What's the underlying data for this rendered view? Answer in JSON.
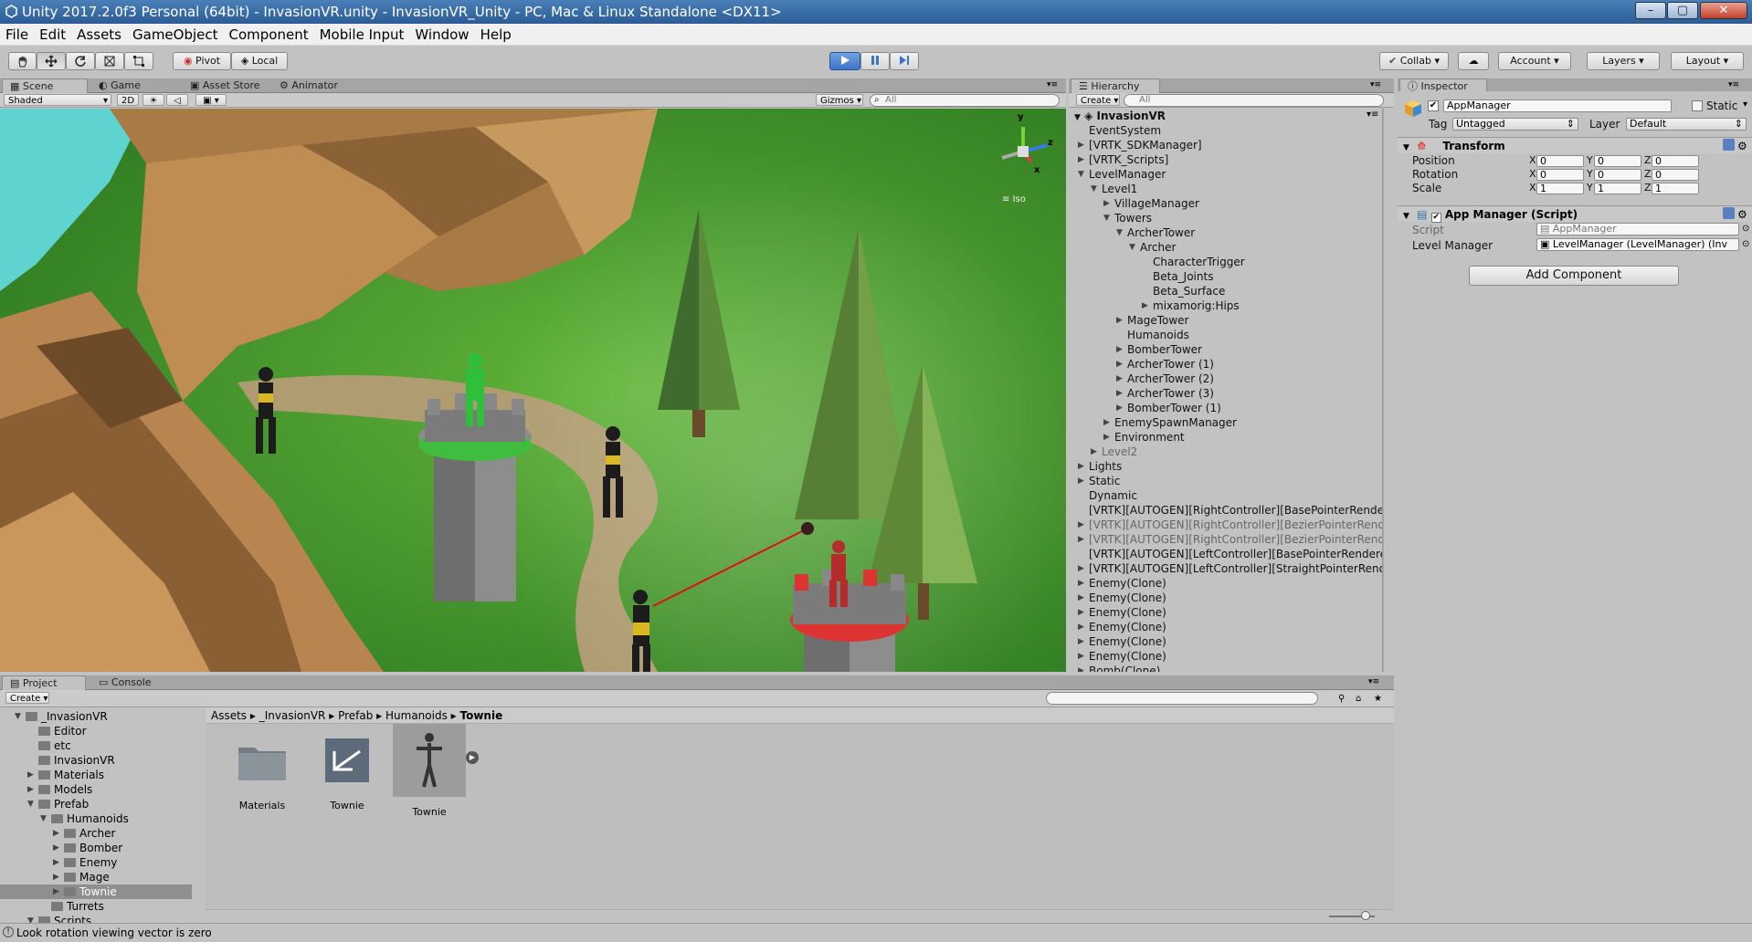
{
  "window": {
    "title": "Unity 2017.2.0f3 Personal (64bit) - InvasionVR.unity - InvasionVR_Unity - PC, Mac & Linux Standalone <DX11>"
  },
  "menu": [
    "File",
    "Edit",
    "Assets",
    "GameObject",
    "Component",
    "Mobile Input",
    "Window",
    "Help"
  ],
  "toolbar": {
    "pivot": "Pivot",
    "local": "Local",
    "collab": "Collab",
    "account": "Account",
    "layers": "Layers",
    "layout": "Layout"
  },
  "scene_tabs": {
    "scene": "Scene",
    "game": "Game",
    "asset_store": "Asset Store",
    "animator": "Animator"
  },
  "scene_bar": {
    "shading": "Shaded",
    "mode2d": "2D",
    "gizmos": "Gizmos",
    "search": "All",
    "iso": "Iso",
    "axis_y": "y",
    "axis_z": "z",
    "axis_x": "x"
  },
  "hierarchy": {
    "tab": "Hierarchy",
    "create": "Create",
    "search": "All",
    "scene_name": "InvasionVR",
    "items": [
      {
        "label": "EventSystem",
        "depth": 0,
        "arrow": "",
        "style": ""
      },
      {
        "label": "[VRTK_SDKManager]",
        "depth": 0,
        "arrow": "right",
        "style": ""
      },
      {
        "label": "[VRTK_Scripts]",
        "depth": 0,
        "arrow": "right",
        "style": ""
      },
      {
        "label": "LevelManager",
        "depth": 0,
        "arrow": "down",
        "style": ""
      },
      {
        "label": "Level1",
        "depth": 1,
        "arrow": "down",
        "style": ""
      },
      {
        "label": "VillageManager",
        "depth": 2,
        "arrow": "right",
        "style": ""
      },
      {
        "label": "Towers",
        "depth": 2,
        "arrow": "down",
        "style": ""
      },
      {
        "label": "ArcherTower",
        "depth": 3,
        "arrow": "down",
        "style": ""
      },
      {
        "label": "Archer",
        "depth": 4,
        "arrow": "down",
        "style": ""
      },
      {
        "label": "CharacterTrigger",
        "depth": 5,
        "arrow": "",
        "style": ""
      },
      {
        "label": "Beta_Joints",
        "depth": 5,
        "arrow": "",
        "style": ""
      },
      {
        "label": "Beta_Surface",
        "depth": 5,
        "arrow": "",
        "style": ""
      },
      {
        "label": "mixamorig:Hips",
        "depth": 5,
        "arrow": "right",
        "style": ""
      },
      {
        "label": "MageTower",
        "depth": 3,
        "arrow": "right",
        "style": ""
      },
      {
        "label": "Humanoids",
        "depth": 3,
        "arrow": "",
        "style": ""
      },
      {
        "label": "BomberTower",
        "depth": 3,
        "arrow": "right",
        "style": ""
      },
      {
        "label": "ArcherTower (1)",
        "depth": 3,
        "arrow": "right",
        "style": ""
      },
      {
        "label": "ArcherTower (2)",
        "depth": 3,
        "arrow": "right",
        "style": ""
      },
      {
        "label": "ArcherTower (3)",
        "depth": 3,
        "arrow": "right",
        "style": ""
      },
      {
        "label": "BomberTower (1)",
        "depth": 3,
        "arrow": "right",
        "style": ""
      },
      {
        "label": "EnemySpawnManager",
        "depth": 2,
        "arrow": "right",
        "style": ""
      },
      {
        "label": "Environment",
        "depth": 2,
        "arrow": "right",
        "style": ""
      },
      {
        "label": "Level2",
        "depth": 1,
        "arrow": "right",
        "style": "dim"
      },
      {
        "label": "Lights",
        "depth": 0,
        "arrow": "right",
        "style": ""
      },
      {
        "label": "Static",
        "depth": 0,
        "arrow": "right",
        "style": ""
      },
      {
        "label": "Dynamic",
        "depth": 0,
        "arrow": "",
        "style": ""
      },
      {
        "label": "[VRTK][AUTOGEN][RightController][BasePointerRende",
        "depth": 0,
        "arrow": "",
        "style": ""
      },
      {
        "label": "[VRTK][AUTOGEN][RightController][BezierPointerRend",
        "depth": 0,
        "arrow": "right",
        "style": "dim"
      },
      {
        "label": "[VRTK][AUTOGEN][RightController][BezierPointerRend",
        "depth": 0,
        "arrow": "right",
        "style": "dim"
      },
      {
        "label": "[VRTK][AUTOGEN][LeftController][BasePointerRendere",
        "depth": 0,
        "arrow": "",
        "style": ""
      },
      {
        "label": "[VRTK][AUTOGEN][LeftController][StraightPointerRend",
        "depth": 0,
        "arrow": "right",
        "style": ""
      },
      {
        "label": "Enemy(Clone)",
        "depth": 0,
        "arrow": "right",
        "style": ""
      },
      {
        "label": "Enemy(Clone)",
        "depth": 0,
        "arrow": "right",
        "style": ""
      },
      {
        "label": "Enemy(Clone)",
        "depth": 0,
        "arrow": "right",
        "style": ""
      },
      {
        "label": "Enemy(Clone)",
        "depth": 0,
        "arrow": "right",
        "style": ""
      },
      {
        "label": "Enemy(Clone)",
        "depth": 0,
        "arrow": "right",
        "style": ""
      },
      {
        "label": "Enemy(Clone)",
        "depth": 0,
        "arrow": "right",
        "style": ""
      },
      {
        "label": "Bomb(Clone)",
        "depth": 0,
        "arrow": "right",
        "style": ""
      }
    ]
  },
  "inspector": {
    "tab": "Inspector",
    "object_name": "AppManager",
    "static_label": "Static",
    "tag_label": "Tag",
    "tag_value": "Untagged",
    "layer_label": "Layer",
    "layer_value": "Default",
    "transform": {
      "title": "Transform",
      "rows": [
        {
          "label": "Position",
          "x": "0",
          "y": "0",
          "z": "0"
        },
        {
          "label": "Rotation",
          "x": "0",
          "y": "0",
          "z": "0"
        },
        {
          "label": "Scale",
          "x": "1",
          "y": "1",
          "z": "1"
        }
      ]
    },
    "script_component": {
      "title": "App Manager (Script)",
      "script_label": "Script",
      "script_value": "AppManager",
      "level_label": "Level Manager",
      "level_value": "LevelManager (LevelManager) (Inv"
    },
    "add_component": "Add Component"
  },
  "project": {
    "tab_project": "Project",
    "tab_console": "Console",
    "create": "Create",
    "tree": [
      {
        "label": "_InvasionVR",
        "depth": 0,
        "arrow": "down"
      },
      {
        "label": "Editor",
        "depth": 1,
        "arrow": ""
      },
      {
        "label": "etc",
        "depth": 1,
        "arrow": ""
      },
      {
        "label": "InvasionVR",
        "depth": 1,
        "arrow": ""
      },
      {
        "label": "Materials",
        "depth": 1,
        "arrow": "right"
      },
      {
        "label": "Models",
        "depth": 1,
        "arrow": "right"
      },
      {
        "label": "Prefab",
        "depth": 1,
        "arrow": "down"
      },
      {
        "label": "Humanoids",
        "depth": 2,
        "arrow": "down"
      },
      {
        "label": "Archer",
        "depth": 3,
        "arrow": "right"
      },
      {
        "label": "Bomber",
        "depth": 3,
        "arrow": "right"
      },
      {
        "label": "Enemy",
        "depth": 3,
        "arrow": "right"
      },
      {
        "label": "Mage",
        "depth": 3,
        "arrow": "right"
      },
      {
        "label": "Townie",
        "depth": 3,
        "arrow": "right",
        "selected": true
      },
      {
        "label": "Turrets",
        "depth": 2,
        "arrow": ""
      },
      {
        "label": "Scripts",
        "depth": 1,
        "arrow": "down"
      }
    ],
    "breadcrumb": [
      "Assets",
      "_InvasionVR",
      "Prefab",
      "Humanoids",
      "Townie"
    ],
    "assets": [
      {
        "label": "Materials",
        "kind": "folder"
      },
      {
        "label": "Townie",
        "kind": "prefab"
      },
      {
        "label": "Townie",
        "kind": "model"
      }
    ]
  },
  "status": {
    "message": "Look rotation viewing vector is zero"
  },
  "colors": {
    "accent": "#3d74c8",
    "title_bar": "#2b5c95",
    "selection": "#8fa8d6"
  }
}
